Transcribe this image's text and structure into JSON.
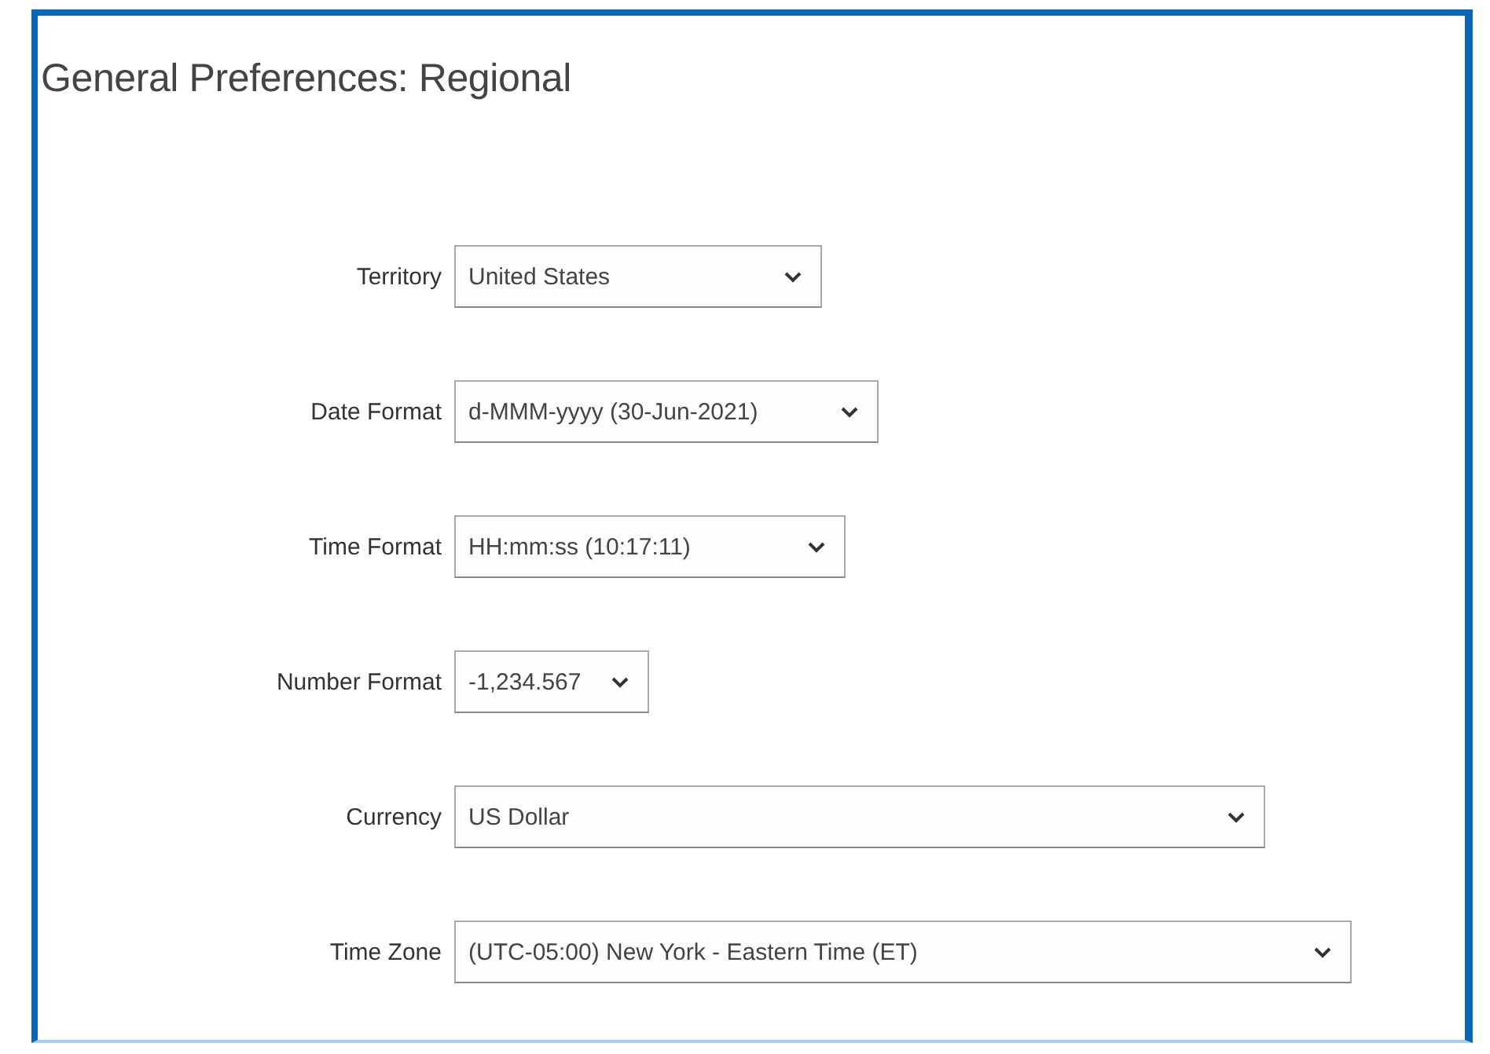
{
  "page": {
    "title": "General Preferences: Regional"
  },
  "fields": [
    {
      "label": "Territory",
      "value": "United States"
    },
    {
      "label": "Date Format",
      "value": "d-MMM-yyyy (30-Jun-2021)"
    },
    {
      "label": "Time Format",
      "value": "HH:mm:ss (10:17:11)"
    },
    {
      "label": "Number Format",
      "value": "-1,234.567"
    },
    {
      "label": "Currency",
      "value": "US Dollar"
    },
    {
      "label": "Time Zone",
      "value": "(UTC-05:00) New York - Eastern Time (ET)"
    }
  ]
}
